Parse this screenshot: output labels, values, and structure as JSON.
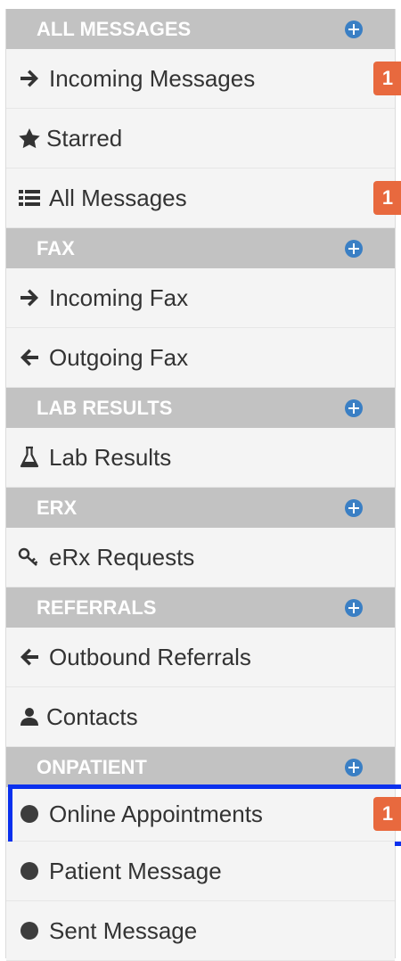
{
  "sections": [
    {
      "header": "ALL MESSAGES",
      "items": [
        {
          "label": "Incoming Messages",
          "icon": "arrow-right-icon",
          "badge": "1"
        },
        {
          "label": "Starred",
          "icon": "star-icon"
        },
        {
          "label": "All Messages",
          "icon": "list-icon",
          "badge": "1"
        }
      ]
    },
    {
      "header": "FAX",
      "items": [
        {
          "label": "Incoming Fax",
          "icon": "arrow-right-icon"
        },
        {
          "label": "Outgoing Fax",
          "icon": "arrow-left-icon"
        }
      ]
    },
    {
      "header": "LAB RESULTS",
      "items": [
        {
          "label": "Lab Results",
          "icon": "flask-icon"
        }
      ]
    },
    {
      "header": "ERX",
      "items": [
        {
          "label": "eRx Requests",
          "icon": "key-icon"
        }
      ]
    },
    {
      "header": "REFERRALS",
      "items": [
        {
          "label": "Outbound Referrals",
          "icon": "arrow-left-icon"
        },
        {
          "label": "Contacts",
          "icon": "user-icon"
        }
      ]
    },
    {
      "header": "ONPATIENT",
      "items": [
        {
          "label": "Online Appointments",
          "icon": "circle-icon",
          "badge": "1",
          "selected": true
        },
        {
          "label": "Patient Message",
          "icon": "circle-icon"
        },
        {
          "label": "Sent Message",
          "icon": "circle-icon"
        }
      ]
    }
  ],
  "colors": {
    "header_bg": "#c2c2c2",
    "item_bg": "#f4f4f4",
    "plus": "#3a7fc4",
    "badge": "#e8693e",
    "selection": "#0a30ee"
  }
}
